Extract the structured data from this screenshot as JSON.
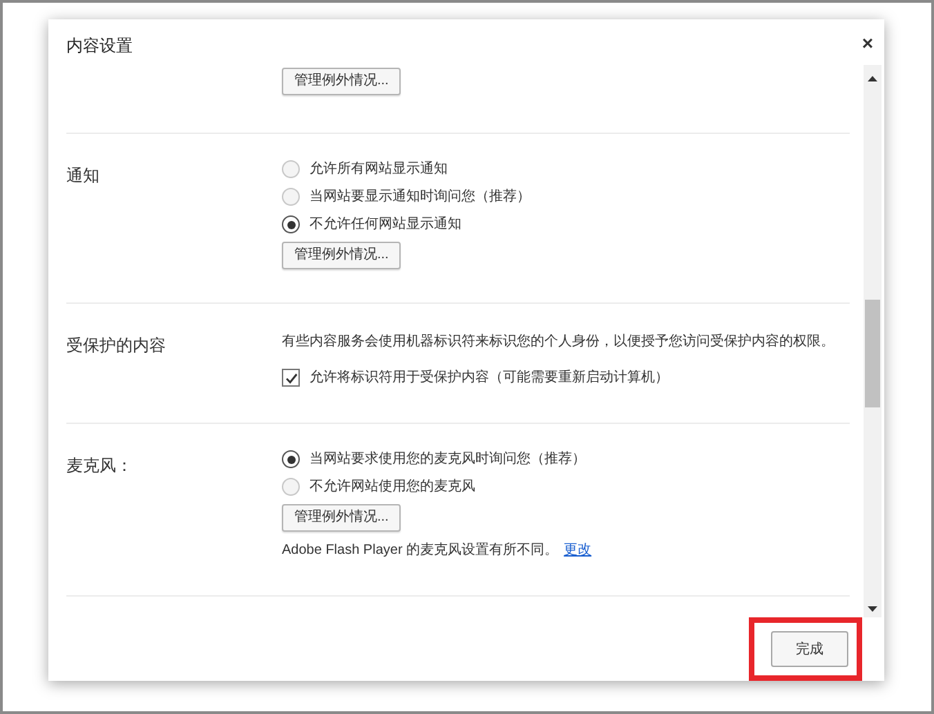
{
  "dialog": {
    "title": "内容设置",
    "close": "×",
    "sections": [
      {
        "items": [
          {
            "kind": "button",
            "text": "管理例外情况..."
          }
        ]
      },
      {
        "label": "通知",
        "items": [
          {
            "kind": "radio",
            "text": "允许所有网站显示通知",
            "selected": false
          },
          {
            "kind": "radio",
            "text": "当网站要显示通知时询问您（推荐）",
            "selected": false
          },
          {
            "kind": "radio",
            "text": "不允许任何网站显示通知",
            "selected": true
          },
          {
            "kind": "button",
            "text": "管理例外情况..."
          }
        ]
      },
      {
        "label": "受保护的内容",
        "items": [
          {
            "kind": "note",
            "text": "有些内容服务会使用机器标识符来标识您的个人身份，以便授予您访问受保护内容的权限。"
          },
          {
            "kind": "checkbox",
            "text": "允许将标识符用于受保护内容（可能需要重新启动计算机）",
            "checked": true
          }
        ]
      },
      {
        "label": "麦克风：",
        "items": [
          {
            "kind": "radio",
            "text": "当网站要求使用您的麦克风时询问您（推荐）",
            "selected": true
          },
          {
            "kind": "radio",
            "text": "不允许网站使用您的麦克风",
            "selected": false
          },
          {
            "kind": "button",
            "text": "管理例外情况..."
          },
          {
            "kind": "note",
            "text": "Adobe Flash Player 的麦克风设置有所不同。",
            "link": "更改"
          }
        ]
      }
    ],
    "done_button": {
      "text": "完成",
      "highlighted": true
    }
  }
}
